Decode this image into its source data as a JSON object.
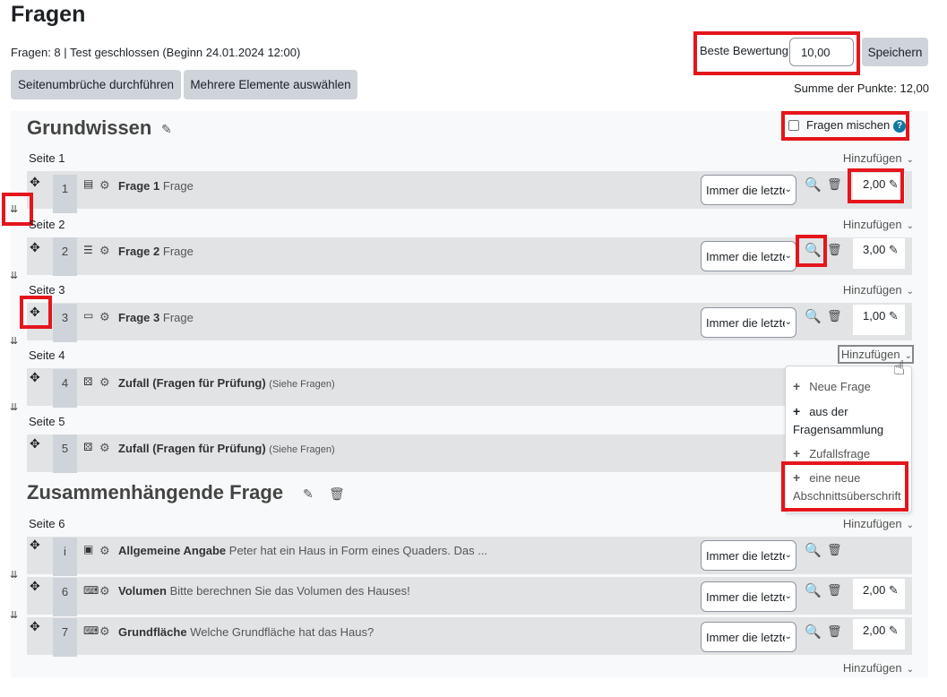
{
  "page": {
    "title": "Fragen",
    "info": "Fragen: 8 | Test geschlossen (Beginn 24.01.2024 12:00)",
    "repaginate_button": "Seitenumbrüche durchführen",
    "select_multiple_button": "Mehrere Elemente auswählen",
    "max_grade_label": "Beste Bewertung",
    "max_grade_value": "10,00",
    "save_button": "Speichern",
    "total_marks": "Summe der Punkte: 12,00"
  },
  "sections": [
    {
      "heading": "Grundwissen",
      "shuffle_label": "Fragen mischen",
      "shuffle_checked": false
    },
    {
      "heading": "Zusammenhängende Frage"
    }
  ],
  "pages": [
    "Seite 1",
    "Seite 2",
    "Seite 3",
    "Seite 4",
    "Seite 5",
    "Seite 6"
  ],
  "add_label": "Hinzufügen",
  "questions": [
    {
      "num": "1",
      "icon": "essay-icon",
      "name": "Frage 1",
      "text": "Frage",
      "behaviour": "Immer die letzte",
      "mark": "2,00"
    },
    {
      "num": "2",
      "icon": "multichoice-icon",
      "name": "Frage 2",
      "text": "Frage",
      "behaviour": "Immer die letzte",
      "mark": "3,00"
    },
    {
      "num": "3",
      "icon": "shortanswer-icon",
      "name": "Frage 3",
      "text": "Frage",
      "behaviour": "Immer die letzte",
      "mark": "1,00"
    },
    {
      "num": "4",
      "icon": "random-icon",
      "name": "Zufall (Fragen für Prüfung)",
      "text": "(Siehe Fragen)"
    },
    {
      "num": "5",
      "icon": "random-icon",
      "name": "Zufall (Fragen für Prüfung)",
      "text": "(Siehe Fragen)"
    },
    {
      "num": "i",
      "icon": "description-icon",
      "name": "Allgemeine Angabe",
      "text": "Peter hat ein Haus in Form eines Quaders. Das ...",
      "behaviour": "Immer die letzte"
    },
    {
      "num": "6",
      "icon": "numerical-icon",
      "name": "Volumen",
      "text": "Bitte berechnen Sie das Volumen des Hauses!",
      "behaviour": "Immer die letzte",
      "mark": "2,00"
    },
    {
      "num": "7",
      "icon": "numerical-icon",
      "name": "Grundfläche",
      "text": "Welche Grundfläche hat das Haus?",
      "behaviour": "Immer die letzte",
      "mark": "2,00"
    }
  ],
  "add_menu": {
    "items": [
      "Neue Frage",
      "aus der Fragensammlung",
      "Zufallsfrage",
      "eine neue Abschnittsüberschrift"
    ]
  },
  "colors": {
    "highlight": "#e4161c",
    "slot_bg": "#e2e3e5",
    "button_bg": "#ced4da",
    "help": "#1177a0"
  }
}
